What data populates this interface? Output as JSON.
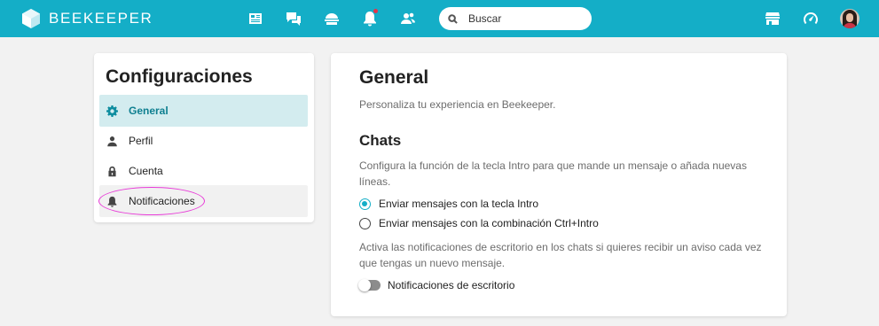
{
  "topbar": {
    "brand": "BEEKEEPER",
    "brand_color": "#14aec7",
    "nav_icons": [
      "news-feed-icon",
      "chat-icon",
      "campus-icon",
      "notifications-icon",
      "contacts-icon"
    ],
    "search": {
      "placeholder": "Buscar"
    },
    "right_icons": [
      "marketplace-icon",
      "dashboard-icon",
      "avatar"
    ]
  },
  "sidebar": {
    "title": "Configuraciones",
    "items": [
      {
        "label": "General",
        "icon": "gear-icon",
        "active": true
      },
      {
        "label": "Perfil",
        "icon": "person-icon",
        "active": false
      },
      {
        "label": "Cuenta",
        "icon": "lock-icon",
        "active": false
      },
      {
        "label": "Notificaciones",
        "icon": "bell-icon",
        "active": false
      }
    ]
  },
  "main": {
    "title": "General",
    "subtitle": "Personaliza tu experiencia en Beekeeper.",
    "chats": {
      "title": "Chats",
      "enter_desc": "Configura la función de la tecla Intro para que mande un mensaje o añada nuevas líneas.",
      "options": [
        {
          "label": "Enviar mensajes con la tecla Intro",
          "selected": true
        },
        {
          "label": "Enviar mensajes con la combinación Ctrl+Intro",
          "selected": false
        }
      ],
      "notif_desc": "Activa las notificaciones de escritorio en los chats si quieres recibir un aviso cada vez que tengas un nuevo mensaje.",
      "toggle_label": "Notificaciones de escritorio",
      "toggle_on": false
    }
  }
}
